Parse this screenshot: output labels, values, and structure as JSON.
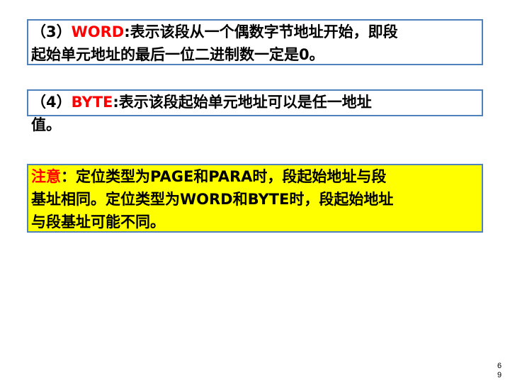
{
  "word": {
    "line1_prefix": "（3）",
    "line1_keyword": "WORD",
    "line1_text": ":表示该段从一个偶数字节地址开始，即段",
    "line2": "起始单元地址的最后一位二进制数一定是0。"
  },
  "byte": {
    "line1_prefix": "（4）",
    "line1_keyword": "BYTE",
    "line1_text": ":表示该段起始单元地址可以是任一地址",
    "line2": "值。"
  },
  "note": {
    "label": "注意",
    "line1_text": "：定位类型为PAGE和PARA时，段起始地址与段",
    "line2": "基址相同。定位类型为WORD和BYTE时，段起始地址",
    "line3": "与段基址可能不同。"
  },
  "page_number": "69",
  "colors": {
    "keyword": "#ff0000",
    "box_border": "#4f81bd",
    "note_background": "#ffff00"
  }
}
